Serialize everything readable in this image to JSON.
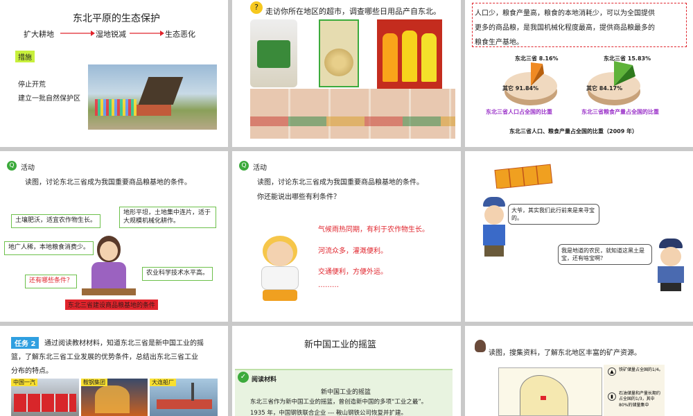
{
  "slide1": {
    "title": "东北平原的生态保护",
    "flow": [
      "扩大耕地",
      "湿地锐减",
      "生态恶化"
    ],
    "measures_label": "措施",
    "measures": [
      "停止开荒",
      "建立一批自然保护区"
    ]
  },
  "slide2": {
    "prompt": "走访你所在地区的超市，调查哪些日用品产自东北。"
  },
  "slide3": {
    "text_lines": [
      "人口少，粮食产量高，粮食的本地消耗少，可以为全国提供",
      "更多的商品粮，是我国机械化程度最高，提供商品粮最多的",
      "粮食生产基地。"
    ],
    "pie1": {
      "label_top": "东北三省 8.16%",
      "label_other": "其它 91.84%",
      "caption": "东北三省人口占全国的比重"
    },
    "pie2": {
      "label_top": "东北三省 15.83%",
      "label_other": "其它 84.17%",
      "caption": "东北三省粮食产量占全国的比重"
    },
    "footer": "东北三省人口、粮食产量占全国的比重（2009 年）"
  },
  "slide4": {
    "activity": "活动",
    "prompt": "读图，讨论东北三省成为我国重要商品粮基地的条件。",
    "boxes": [
      "土壤肥沃，适宜农作物生长。",
      "地形平坦，土地集中连片，适于大规模机械化耕作。",
      "地广人稀，本地粮食消费少。",
      "还有哪些条件？",
      "农业科学技术水平高。"
    ],
    "caption": "东北三省建设商品粮基地的条件"
  },
  "slide5": {
    "activity": "活动",
    "prompt1": "读图，讨论东北三省成为我国重要商品粮基地的条件。",
    "prompt2": "你还能说出哪些有利条件？",
    "answers": [
      "气候雨热同期，有利于农作物生长。",
      "河流众多，灌溉便利。",
      "交通便利，方便外运。",
      "………"
    ]
  },
  "slide6": {
    "bubble1": "大爷，其实我们此行前来是来寻宝的。",
    "bubble2": "我是地道的农民，就知道这黑土是宝，还有啥宝啊？"
  },
  "slide7": {
    "task_label": "任务 2",
    "text_lines": [
      "通过阅读教材材料，知道东北三省是新中国工业的摇",
      "篮，了解东北三省工业发展的优势条件，总结出东北三省工业",
      "分布的特点。"
    ],
    "photos": [
      "中国一汽",
      "鞍钢集团",
      "大连船厂"
    ]
  },
  "slide8": {
    "title": "新中国工业的摇篮",
    "reading_label": "阅读材料",
    "reading_title": "新中国工业的摇篮",
    "lines": [
      "东北三省作为新中国工业的摇篮，曾创造新中国的多项“工业之最”。",
      "1935 年，中国钢铁联合企业 --- 鞍山钢铁公司恢复并扩建。"
    ]
  },
  "slide9": {
    "prompt": "读图，搜集资料，了解东北地区丰富的矿产资源。",
    "notes": [
      "铁矿储量占全国的1/4。",
      "石油储量和产量长期约占全国的1/3，其中80%的储量集中"
    ]
  },
  "colors": {
    "accent_green": "#6cc04a",
    "red": "#e0242c",
    "purple": "#9b33c9",
    "task_blue": "#2f9fe0"
  }
}
